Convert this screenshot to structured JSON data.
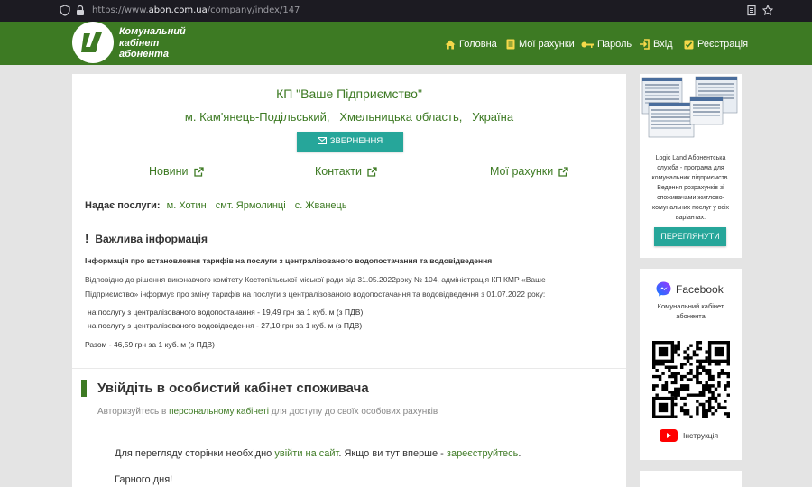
{
  "browser": {
    "url_prefix": "https://www.",
    "url_domain": "abon.com.ua",
    "url_path": "/company/index/147"
  },
  "header": {
    "logo_line1": "Комунальний",
    "logo_line2": "кабінет",
    "logo_line3": "абонента",
    "nav": [
      {
        "label": "Головна",
        "icon": "home-icon"
      },
      {
        "label": "Мої рахунки",
        "icon": "document-icon"
      },
      {
        "label": "Пароль",
        "icon": "key-icon"
      },
      {
        "label": "Вхід",
        "icon": "login-icon"
      },
      {
        "label": "Реєстрація",
        "icon": "checkbox-icon"
      }
    ]
  },
  "company": {
    "name": "КП \"Ваше Підприємство\"",
    "city": "м. Кам'янець-Подільський,",
    "region": "Хмельницька область,",
    "country": "Україна",
    "appeal_button": "ЗВЕРНЕННЯ",
    "links": [
      "Новини",
      "Контакти",
      "Мої рахунки"
    ]
  },
  "services": {
    "label": "Надає послуги:",
    "locations": [
      "м. Хотин",
      "смт. Ярмолинці",
      "с. Жванець"
    ]
  },
  "important": {
    "title": "Важлива інформація",
    "heading": "Інформація про встановлення тарифів на послуги з централізованого водопостачання та водовідведення",
    "paragraph_line1": "Відповідно до рішення виконавчого комітету Костопільської міської ради від 31.05.2022року № 104, адміністрація КП КМР «Ваше",
    "paragraph_line2": "Підприємство» інформує про зміну тарифів на послуги з централізованого водопостачання та водовідведення з 01.07.2022 року:",
    "tariff1": "на послугу з централізованого водопостачання - 19,49 грн за 1 куб. м (з ПДВ)",
    "tariff2": "на послугу з централізованого водовідведення - 27,10 грн за 1 куб. м (з ПДВ)",
    "total": "Разом - 46,59 грн за 1 куб. м (з ПДВ)"
  },
  "signin": {
    "title": "Увійдіть в особистий кабінет споживача",
    "sub_a": "Авторизуйтесь в ",
    "sub_b": "персональному кабінеті",
    "sub_c": " для доступу до своїх особових рахунків",
    "p1_a": "Для перегляду сторінки необхідно ",
    "p1_b": "увійти на сайт",
    "p1_c": ". Якщо ви тут вперше - ",
    "p1_d": "зареєструйтесь",
    "p1_e": ".",
    "p2": "Гарного дня!"
  },
  "sidebar": {
    "desc_line1": "Logic Land Абонентська",
    "desc_line2": "служба - програма для",
    "desc_line3": "комунальних підприємств.",
    "desc_line4": "Ведення розрахунків зі",
    "desc_line5": "споживачами житлово-",
    "desc_line6": "комунальних послуг у всіх",
    "desc_line7": "варіантах.",
    "view_button": "ПЕРЕГЛЯНУТИ",
    "facebook_label": "Facebook",
    "facebook_desc1": "Комунальний кабінет",
    "facebook_desc2": "абонента",
    "youtube_label": "Інструкція"
  },
  "colors": {
    "brand": "#3d7a23",
    "accent": "#26a69a",
    "background": "#e4e4e4"
  }
}
